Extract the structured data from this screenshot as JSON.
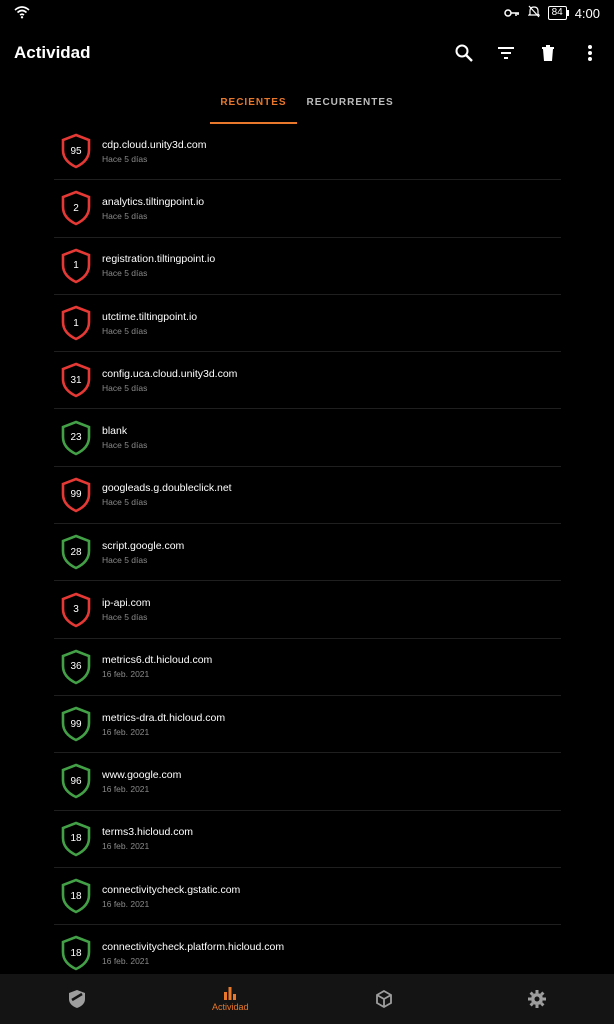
{
  "status": {
    "battery": "84",
    "time": "4:00"
  },
  "app": {
    "title": "Actividad"
  },
  "tabs": [
    {
      "label": "RECIENTES"
    },
    {
      "label": "RECURRENTES"
    }
  ],
  "colors": {
    "accent": "#e8782b",
    "red": "#e53935",
    "green": "#43a047"
  },
  "items": [
    {
      "count": "95",
      "domain": "cdp.cloud.unity3d.com",
      "time": "Hace 5 días",
      "color": "red"
    },
    {
      "count": "2",
      "domain": "analytics.tiltingpoint.io",
      "time": "Hace 5 días",
      "color": "red"
    },
    {
      "count": "1",
      "domain": "registration.tiltingpoint.io",
      "time": "Hace 5 días",
      "color": "red"
    },
    {
      "count": "1",
      "domain": "utctime.tiltingpoint.io",
      "time": "Hace 5 días",
      "color": "red"
    },
    {
      "count": "31",
      "domain": "config.uca.cloud.unity3d.com",
      "time": "Hace 5 días",
      "color": "red"
    },
    {
      "count": "23",
      "domain": "blank",
      "time": "Hace 5 días",
      "color": "green"
    },
    {
      "count": "99",
      "domain": "googleads.g.doubleclick.net",
      "time": "Hace 5 días",
      "color": "red"
    },
    {
      "count": "28",
      "domain": "script.google.com",
      "time": "Hace 5 días",
      "color": "green"
    },
    {
      "count": "3",
      "domain": "ip-api.com",
      "time": "Hace 5 días",
      "color": "red"
    },
    {
      "count": "36",
      "domain": "metrics6.dt.hicloud.com",
      "time": "16 feb. 2021",
      "color": "green"
    },
    {
      "count": "99",
      "domain": "metrics-dra.dt.hicloud.com",
      "time": "16 feb. 2021",
      "color": "green"
    },
    {
      "count": "96",
      "domain": "www.google.com",
      "time": "16 feb. 2021",
      "color": "green"
    },
    {
      "count": "18",
      "domain": "terms3.hicloud.com",
      "time": "16 feb. 2021",
      "color": "green"
    },
    {
      "count": "18",
      "domain": "connectivitycheck.gstatic.com",
      "time": "16 feb. 2021",
      "color": "green"
    },
    {
      "count": "18",
      "domain": "connectivitycheck.platform.hicloud.com",
      "time": "16 feb. 2021",
      "color": "green"
    }
  ],
  "nav": [
    {
      "label": "",
      "icon": "shield-icon"
    },
    {
      "label": "Actividad",
      "icon": "bar-chart-icon"
    },
    {
      "label": "",
      "icon": "box-icon"
    },
    {
      "label": "",
      "icon": "gear-icon"
    }
  ]
}
